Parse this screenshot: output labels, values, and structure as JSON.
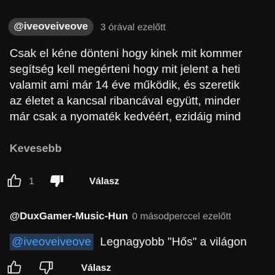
{
  "colors": {
    "background": "#0f0f0f",
    "text_primary": "#f1f1f1",
    "text_secondary": "#aaaaaa",
    "handle_pill": "#3b3b3b",
    "mention_link": "#3ea6ff",
    "mention_bg": "#263850"
  },
  "comments": [
    {
      "author": "@iveoveiveove",
      "time": "3 órával ezelőtt",
      "lines": [
        "Csak el kéne dönteni hogy kinek mit kommer",
        "segítség kell megérteni hogy mit jelent a heti",
        "valamit ami már 14 éve működik, és szeretik",
        "az életet a kancsal ribancával együtt, minder",
        "már csak a nyomaték kedvéért, ezidáig mind"
      ],
      "show_less_label": "Kevesebb",
      "like_count": "1",
      "reply_label": "Válasz",
      "icons": {
        "like": "thumbs-up-icon",
        "dislike": "thumbs-down-filled-icon"
      }
    },
    {
      "author": "@DuxGamer-Music-Hun",
      "time": "0 másodperccel ezelőtt",
      "mention": "@iveoveiveove",
      "text": "Legnagyobb \"Hős\" a világon",
      "reply_label": "Válasz",
      "icons": {
        "like": "thumbs-up-icon",
        "dislike": "thumbs-down-icon"
      }
    }
  ]
}
